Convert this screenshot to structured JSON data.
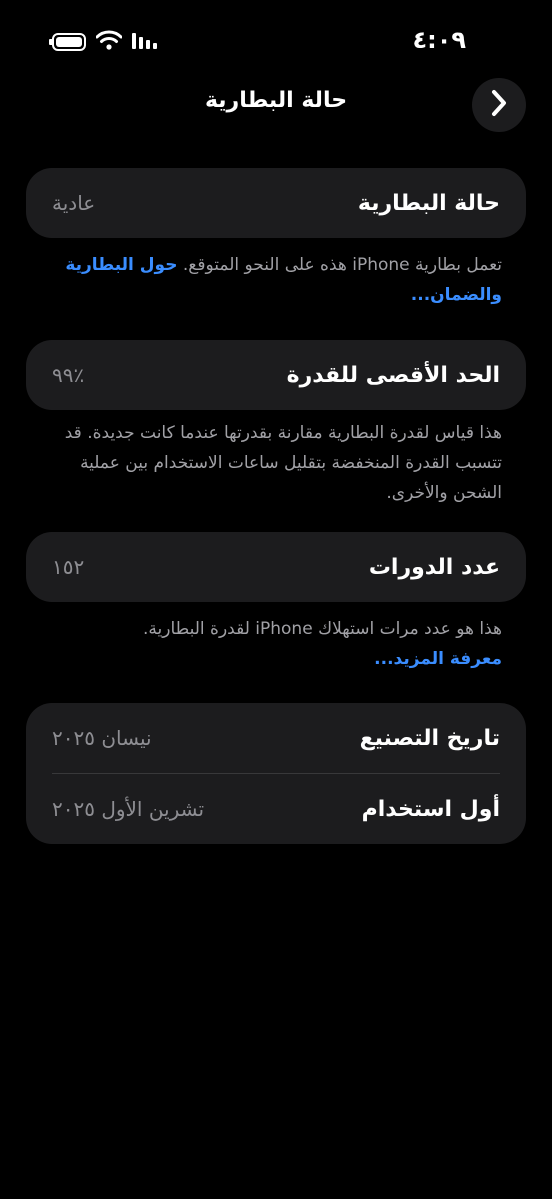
{
  "status_bar": {
    "time": "٤:٠٩",
    "icons": [
      "battery-icon",
      "wifi-icon",
      "signal-icon"
    ]
  },
  "nav": {
    "title": "حالة البطارية",
    "back_icon": "chevron-right-icon"
  },
  "sections": {
    "health": {
      "label": "حالة البطارية",
      "value": "عادية",
      "footer_text": "تعمل بطارية iPhone هذه على النحو المتوقع.",
      "footer_link": "حول البطارية والضمان..."
    },
    "capacity": {
      "label": "الحد الأقصى للقدرة",
      "value": "٪٩٩",
      "footer_text": "هذا قياس لقدرة البطارية مقارنة بقدرتها عندما كانت جديدة. قد تتسبب القدرة المنخفضة بتقليل ساعات الاستخدام بين عملية الشحن والأخرى."
    },
    "cycles": {
      "label": "عدد الدورات",
      "value": "١٥٢",
      "footer_text": "هذا هو عدد مرات استهلاك iPhone لقدرة البطارية.",
      "footer_link": "معرفة المزيد..."
    },
    "dates": {
      "manufacture_label": "تاريخ التصنيع",
      "manufacture_value": "نيسان ٢٠٢٥",
      "first_use_label": "أول استخدام",
      "first_use_value": "تشرين الأول ٢٠٢٥"
    }
  },
  "colors": {
    "background": "#000000",
    "card": "#1c1c1e",
    "link": "#3a8dff",
    "secondary_text": "#8e8e93"
  }
}
